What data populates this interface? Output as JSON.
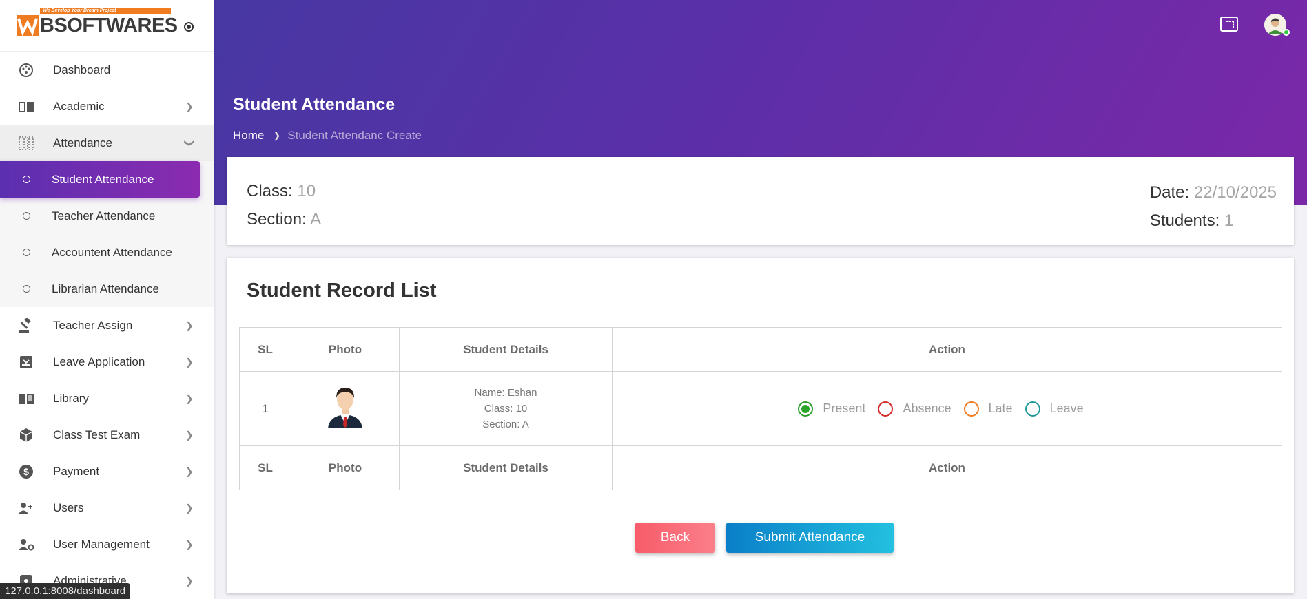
{
  "brand": {
    "tagline": "We Develop Your Dream Project",
    "name": "SOFTWARES",
    "colors": {
      "accent_start": "#4738a3",
      "accent_end": "#7b28a8",
      "logo_orange": "#f07c22"
    }
  },
  "sidebar": {
    "items": [
      {
        "label": "Dashboard",
        "icon": "dashboard-icon",
        "chevron": false
      },
      {
        "label": "Academic",
        "icon": "book-icon",
        "chevron": true
      },
      {
        "label": "Attendance",
        "icon": "attendance-icon",
        "chevron": true,
        "open": true
      },
      {
        "label": "Teacher Assign",
        "icon": "gavel-icon",
        "chevron": true
      },
      {
        "label": "Leave Application",
        "icon": "inbox-icon",
        "chevron": true
      },
      {
        "label": "Library",
        "icon": "library-icon",
        "chevron": true
      },
      {
        "label": "Class Test Exam",
        "icon": "cube-icon",
        "chevron": true
      },
      {
        "label": "Payment",
        "icon": "dollar-icon",
        "chevron": true
      },
      {
        "label": "Users",
        "icon": "users-icon",
        "chevron": true
      },
      {
        "label": "User Management",
        "icon": "user-gear-icon",
        "chevron": true
      },
      {
        "label": "Administrative",
        "icon": "admin-icon",
        "chevron": true
      }
    ],
    "attendance_sub": [
      {
        "label": "Student Attendance",
        "active": true
      },
      {
        "label": "Teacher Attendance",
        "active": false
      },
      {
        "label": "Accountent Attendance",
        "active": false
      },
      {
        "label": "Librarian Attendance",
        "active": false
      }
    ]
  },
  "status_url": "127.0.0.1:8008/dashboard",
  "header": {
    "title": "Student Attendance",
    "breadcrumb_home": "Home",
    "breadcrumb_current": "Student Attendanc Create"
  },
  "info": {
    "class_label": "Class:",
    "class_value": "10",
    "section_label": "Section:",
    "section_value": "A",
    "date_label": "Date:",
    "date_value": "22/10/2025",
    "students_label": "Students:",
    "students_value": "1"
  },
  "record_list": {
    "title": "Student Record List",
    "columns": [
      "SL",
      "Photo",
      "Student Details",
      "Action"
    ],
    "rows": [
      {
        "sl": "1",
        "name": "Name: Eshan",
        "class": "Class: 10",
        "section": "Section: A",
        "selected": "Present"
      }
    ],
    "options": [
      "Present",
      "Absence",
      "Late",
      "Leave"
    ]
  },
  "buttons": {
    "back": "Back",
    "submit": "Submit Attendance"
  }
}
